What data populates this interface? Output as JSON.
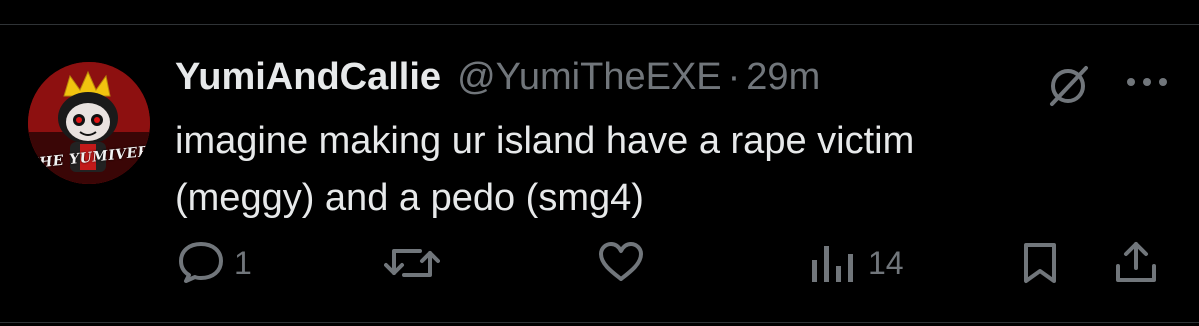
{
  "tweet": {
    "display_name": "YumiAndCallie",
    "handle": "@YumiTheEXE",
    "separator": "·",
    "time": "29m",
    "text": "imagine making ur island have a rape victim\n(meggy) and a pedo (smg4)"
  },
  "avatar": {
    "banner_text": "THE YUMIVERSE"
  },
  "actions": {
    "reply_count": "1",
    "views_count": "14"
  },
  "colors": {
    "background": "#000000",
    "text_primary": "#e7e9ea",
    "text_secondary": "#71767b",
    "divider": "#2f3336"
  },
  "icons": {
    "grok": "slashed-circle-icon",
    "more": "more-horizontal-icon",
    "reply": "reply-icon",
    "retweet": "retweet-icon",
    "like": "heart-icon",
    "views": "views-chart-icon",
    "bookmark": "bookmark-icon",
    "share": "share-icon"
  }
}
